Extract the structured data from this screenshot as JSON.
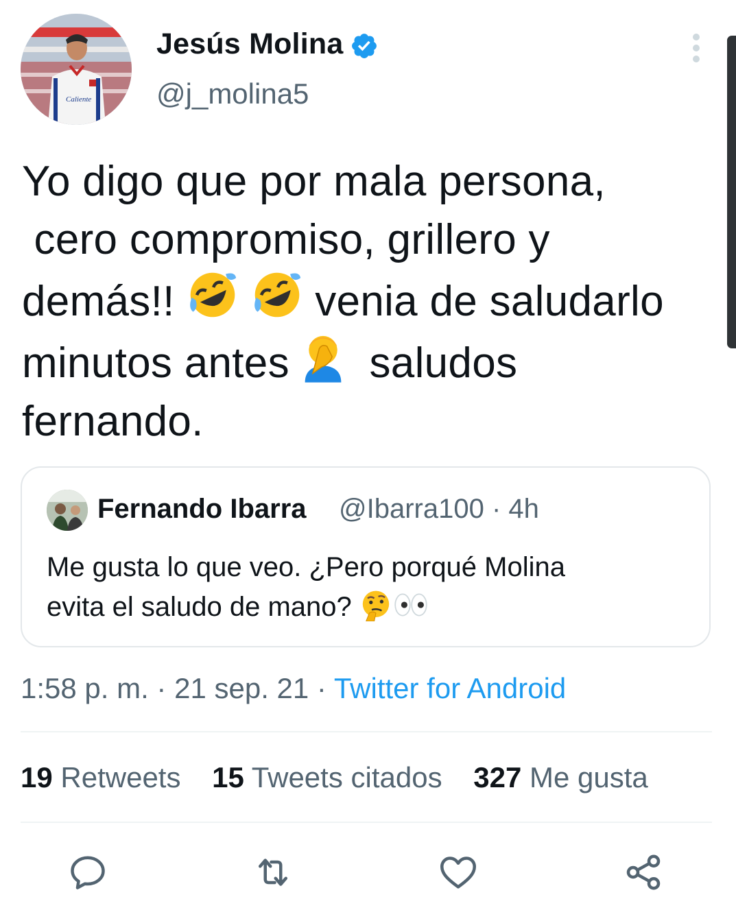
{
  "author": {
    "display_name": "Jesús Molina",
    "handle": "@j_molina5",
    "verified_icon": "verified-badge-icon"
  },
  "tweet": {
    "line1": "Yo digo que por mala persona,",
    "line2": " cero compromiso, grillero y",
    "line3a": "demás!!",
    "line3b": "venia de saludarlo",
    "line4a": "minutos antes",
    "line4b": "saludos",
    "line5": "fernando."
  },
  "quoted": {
    "display_name": "Fernando Ibarra",
    "meta": "@Ibarra100 · 4h",
    "line1": "Me gusta lo que veo. ¿Pero porqué Molina",
    "line2": "evita el saludo de mano?"
  },
  "timestamp": {
    "time_date": "1:58 p. m. · 21 sep. 21 · ",
    "source": "Twitter for Android"
  },
  "stats": [
    {
      "count": "19",
      "label": "Retweets"
    },
    {
      "count": "15",
      "label": "Tweets citados"
    },
    {
      "count": "327",
      "label": "Me gusta"
    }
  ],
  "actions": [
    "reply-icon",
    "retweet-icon",
    "like-icon",
    "share-icon"
  ],
  "colors": {
    "link": "#1d9bf0",
    "muted": "#536471",
    "text": "#0f1419",
    "border": "#e3e7ea"
  }
}
